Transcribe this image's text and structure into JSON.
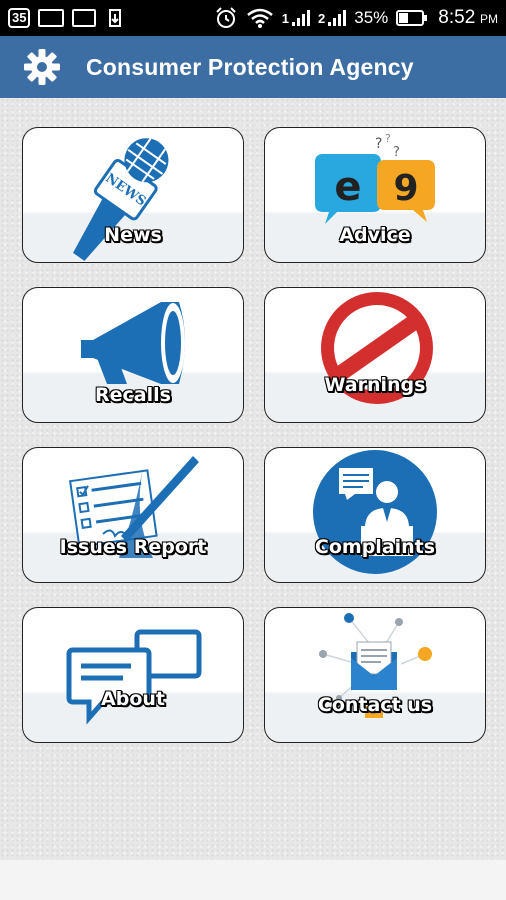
{
  "status_bar": {
    "badge": "35",
    "signal_1": "1",
    "signal_2": "2",
    "battery": "35%",
    "battery_level": 0.35,
    "time": "8:52",
    "ampm": "PM"
  },
  "app_bar": {
    "title": "Consumer Protection Agency",
    "color": "#3d6ea3"
  },
  "tiles": [
    {
      "label": "News",
      "icon": "news-microphone-icon"
    },
    {
      "label": "Advice",
      "icon": "speech-bubbles-icon"
    },
    {
      "label": "Recalls",
      "icon": "megaphone-icon"
    },
    {
      "label": "Warnings",
      "icon": "prohibited-sign-icon"
    },
    {
      "label": "Issues Report",
      "icon": "checklist-pen-icon"
    },
    {
      "label": "Complaints",
      "icon": "speaker-podium-icon"
    },
    {
      "label": "About",
      "icon": "chat-windows-icon"
    },
    {
      "label": "Contact us",
      "icon": "envelope-network-icon"
    }
  ],
  "colors": {
    "icon_blue": "#1d6fb5",
    "warning_red": "#d32f2f"
  }
}
